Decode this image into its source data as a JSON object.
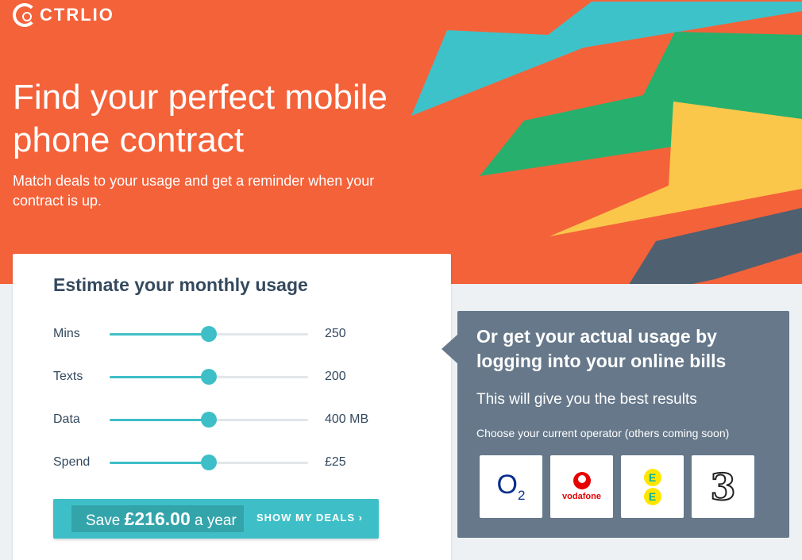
{
  "brand": {
    "logo_text": "CTRLIO",
    "accent": "#f4623a",
    "teal": "#3ebfc7"
  },
  "hero": {
    "title": "Find your perfect mobile phone contract",
    "subtitle": "Match deals to your usage and get a reminder when your contract is up."
  },
  "estimate": {
    "title_bold": "Estimate",
    "title_rest": " your monthly usage",
    "sliders": [
      {
        "label": "Mins",
        "value": "250",
        "fraction": 0.5
      },
      {
        "label": "Texts",
        "value": "200",
        "fraction": 0.5
      },
      {
        "label": "Data",
        "value": "400 MB",
        "fraction": 0.5
      },
      {
        "label": "Spend",
        "value": "£25",
        "fraction": 0.5
      }
    ],
    "save_prefix": "Save ",
    "save_amount": "£216.00",
    "save_suffix": " a year",
    "deals_button": "SHOW MY DEALS  ›"
  },
  "actual": {
    "title_pre": "Or get your ",
    "title_bold": "actual usage",
    "title_post": " by logging into your online bills",
    "subtitle": "This will give you the best results",
    "hint": "Choose your current operator (others coming soon)",
    "operators": [
      {
        "name": "O2",
        "icon": "o2-logo"
      },
      {
        "name": "vodafone",
        "icon": "vodafone-logo"
      },
      {
        "name": "EE",
        "icon": "ee-logo"
      },
      {
        "name": "3",
        "icon": "three-logo"
      }
    ]
  }
}
